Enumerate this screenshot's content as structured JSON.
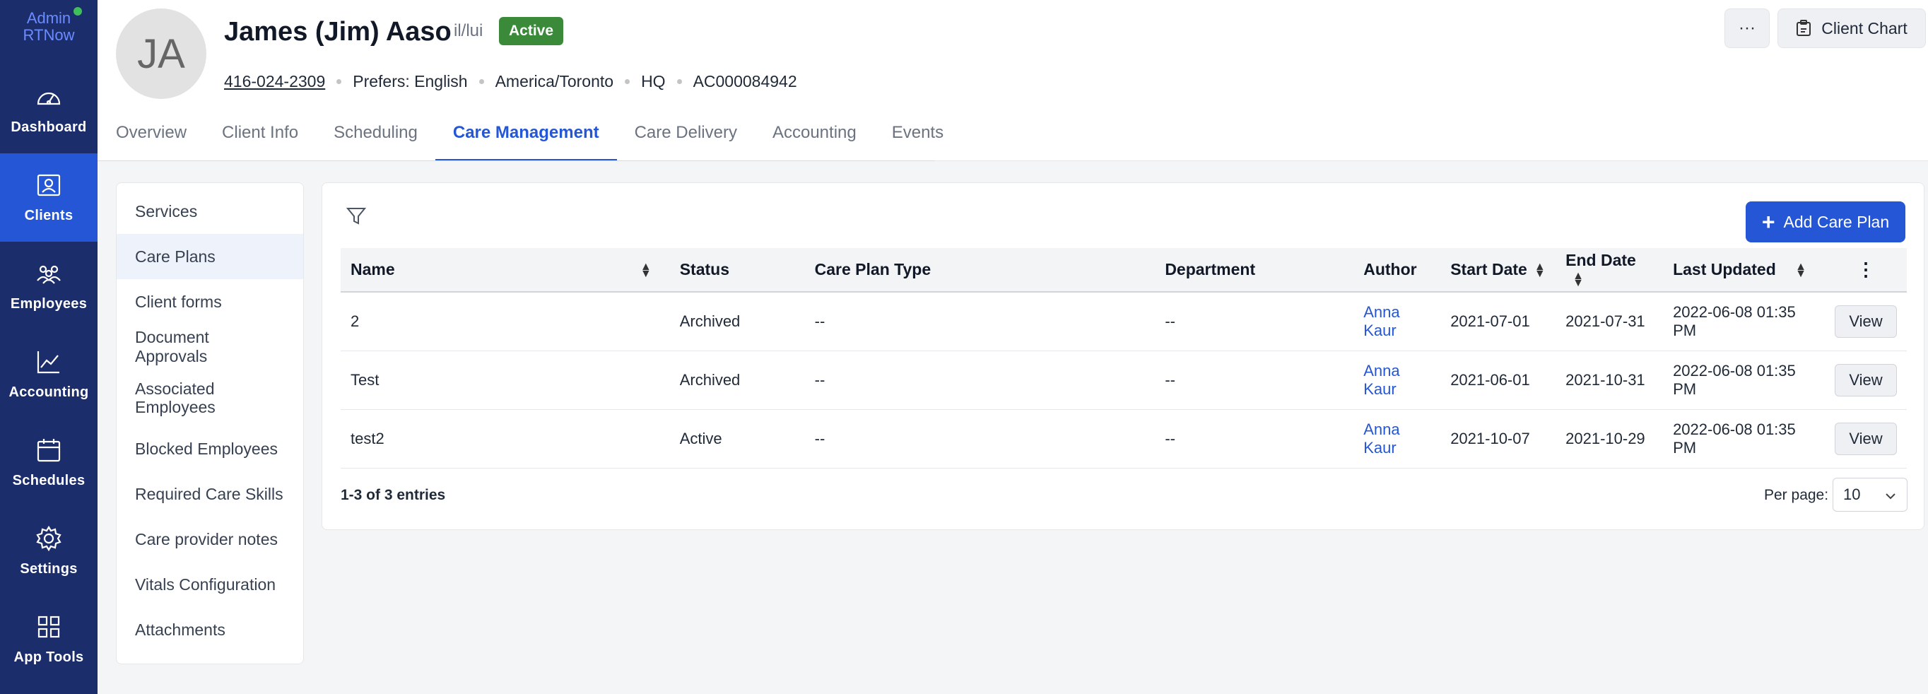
{
  "nav": {
    "logo_text": "Admin RTNow",
    "items": [
      {
        "label": "Dashboard",
        "icon": "gauge-icon"
      },
      {
        "label": "Clients",
        "icon": "client-badge-icon"
      },
      {
        "label": "Employees",
        "icon": "employees-icon"
      },
      {
        "label": "Accounting",
        "icon": "trend-chart-icon"
      },
      {
        "label": "Schedules",
        "icon": "calendar-icon"
      },
      {
        "label": "Settings",
        "icon": "gear-icon"
      },
      {
        "label": "App Tools",
        "icon": "grid-icon"
      }
    ]
  },
  "client": {
    "initials": "JA",
    "name": "James (Jim) Aaso",
    "pronouns": "il/lui",
    "status": "Active",
    "phone": "416-024-2309",
    "language": "Prefers: English",
    "timezone": "America/Toronto",
    "location": "HQ",
    "account_id": "AC000084942"
  },
  "header_actions": {
    "more_label": "···",
    "client_chart_label": "Client Chart"
  },
  "tabs": [
    "Overview",
    "Client Info",
    "Scheduling",
    "Care Management",
    "Care Delivery",
    "Accounting",
    "Events"
  ],
  "side_menu": [
    "Services",
    "Care Plans",
    "Client forms",
    "Document Approvals",
    "Associated Employees",
    "Blocked Employees",
    "Required Care Skills",
    "Care provider notes",
    "Vitals Configuration",
    "Attachments"
  ],
  "care_plans": {
    "add_label": "Add Care Plan",
    "columns": [
      "Name",
      "Status",
      "Care Plan Type",
      "Department",
      "Author",
      "Start Date",
      "End Date",
      "Last Updated"
    ],
    "rows": [
      {
        "name": "2",
        "status": "Archived",
        "type": "--",
        "department": "--",
        "author": "Anna Kaur",
        "start": "2021-07-01",
        "end": "2021-07-31",
        "updated": "2022-06-08 01:35 PM",
        "action": "View"
      },
      {
        "name": "Test",
        "status": "Archived",
        "type": "--",
        "department": "--",
        "author": "Anna Kaur",
        "start": "2021-06-01",
        "end": "2021-10-31",
        "updated": "2022-06-08 01:35 PM",
        "action": "View"
      },
      {
        "name": "test2",
        "status": "Active",
        "type": "--",
        "department": "--",
        "author": "Anna Kaur",
        "start": "2021-10-07",
        "end": "2021-10-29",
        "updated": "2022-06-08 01:35 PM",
        "action": "View"
      }
    ],
    "entries_text": "1-3 of 3 entries",
    "per_page_label": "Per page:",
    "per_page_value": "10"
  },
  "colors": {
    "nav_bg": "#1c2d6b",
    "accent": "#2456d6",
    "status_active": "#3a8a3a"
  }
}
